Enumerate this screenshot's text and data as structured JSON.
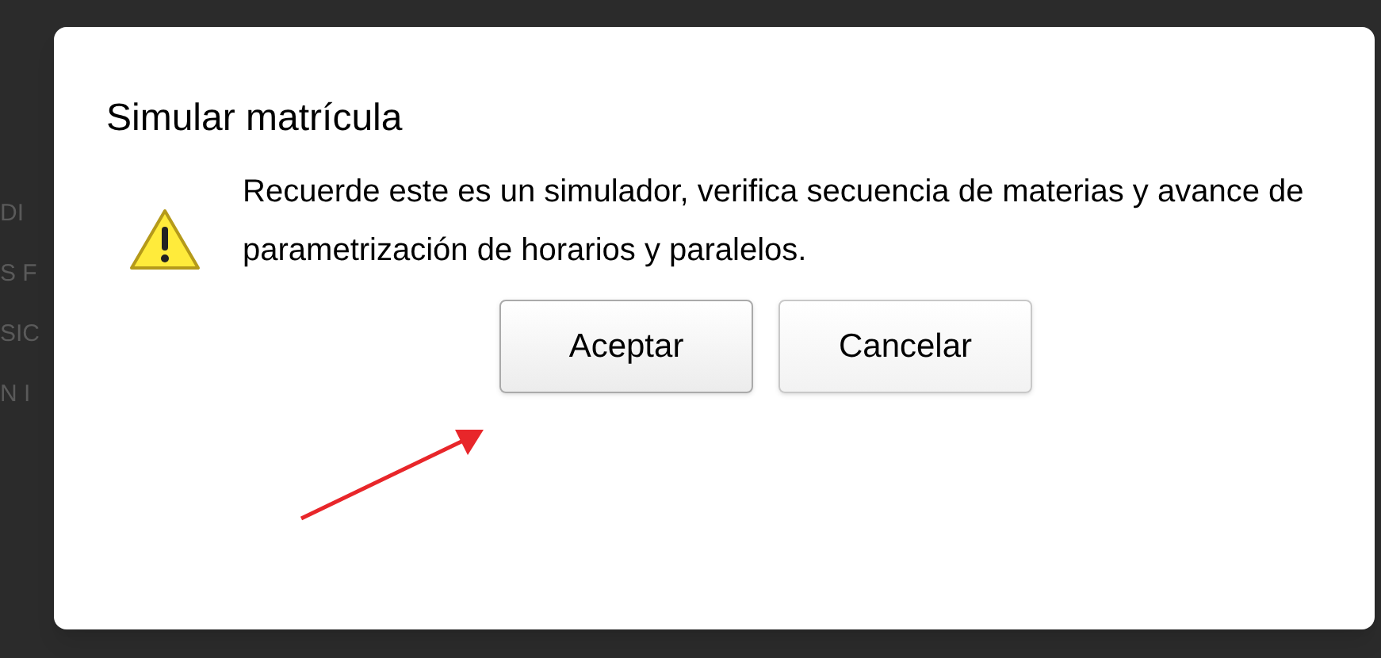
{
  "background": {
    "rows": [
      "DI",
      "S F",
      "SIC",
      "N I"
    ]
  },
  "dialog": {
    "title": "Simular matrícula",
    "message": "Recuerde este es un simulador, verifica secuencia de materias y avance de parametrización de horarios y paralelos.",
    "buttons": [
      {
        "label": "Aceptar",
        "highlighted": true
      },
      {
        "label": "Cancelar",
        "highlighted": false
      }
    ]
  }
}
